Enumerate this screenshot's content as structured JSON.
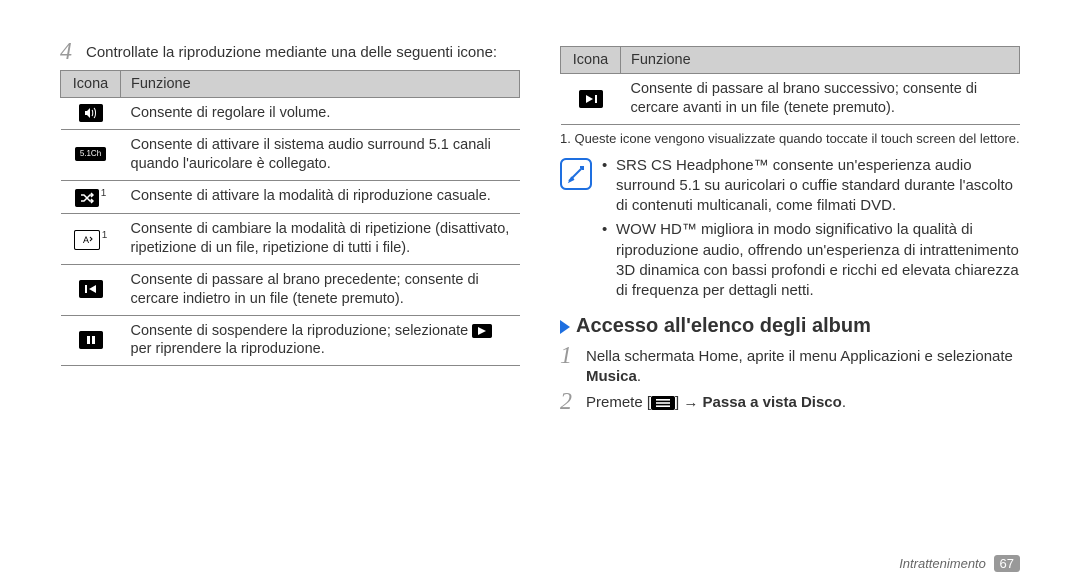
{
  "left": {
    "step4_num": "4",
    "step4_text": "Controllate la riproduzione mediante una delle seguenti icone:",
    "table": {
      "h_icon": "Icona",
      "h_func": "Funzione",
      "rows": [
        {
          "icon_name": "volume-icon",
          "func": "Consente di regolare il volume."
        },
        {
          "icon_name": "surround-icon",
          "icon_text": "5.1Ch",
          "func": "Consente di attivare il sistema audio surround 5.1 canali quando l'auricolare è collegato."
        },
        {
          "icon_name": "shuffle-icon",
          "has_sup": "1",
          "func": "Consente di attivare la modalità di riproduzione casuale."
        },
        {
          "icon_name": "repeat-icon",
          "icon_text": "A",
          "white": true,
          "has_sup": "1",
          "func": "Consente di cambiare la modalità di ripetizione (disattivato, ripetizione di un file, ripetizione di tutti i file)."
        },
        {
          "icon_name": "prev-icon",
          "func": "Consente di passare al brano precedente; consente di cercare indietro in un file (tenete premuto)."
        },
        {
          "icon_name": "pause-icon",
          "func_pre": "Consente di sospendere la riproduzione; selezionate ",
          "func_post": " per riprendere la riproduzione."
        }
      ]
    }
  },
  "right": {
    "table": {
      "h_icon": "Icona",
      "h_func": "Funzione",
      "row": {
        "icon_name": "next-icon",
        "func": "Consente di passare al brano successivo; consente di cercare avanti in un file (tenete premuto)."
      }
    },
    "footnote": "1. Queste icone vengono visualizzate quando toccate il touch screen del lettore.",
    "note": {
      "b1": "SRS CS Headphone™ consente un'esperienza audio surround 5.1 su auricolari o cuffie standard durante l'ascolto di contenuti multicanali, come filmati DVD.",
      "b2": "WOW HD™ migliora in modo significativo la qualità di riproduzione audio, offrendo un'esperienza di intrattenimento 3D dinamica con bassi profondi e ricchi ed elevata chiarezza di frequenza per dettagli netti."
    },
    "section_title": "Accesso all'elenco degli album",
    "step1_num": "1",
    "step1_pre": "Nella schermata Home, aprite il menu Applicazioni e selezionate ",
    "step1_bold": "Musica",
    "step1_post": ".",
    "step2_num": "2",
    "step2_pre": "Premete [",
    "step2_mid": "] → ",
    "step2_bold": "Passa a vista Disco",
    "step2_post": "."
  },
  "footer_section": "Intrattenimento",
  "footer_page": "67"
}
